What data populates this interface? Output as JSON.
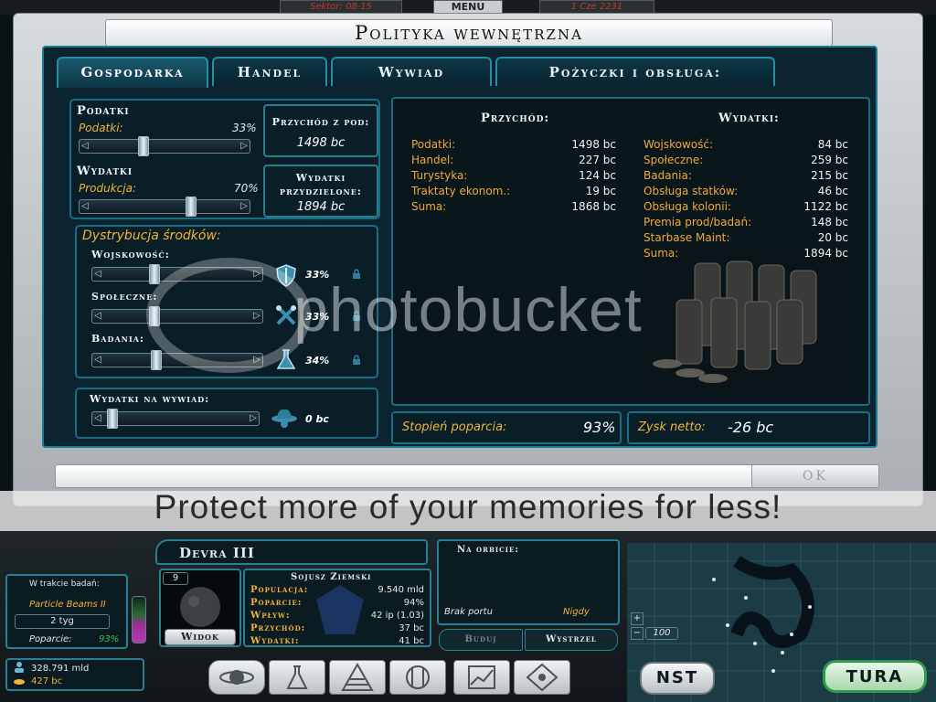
{
  "topbar": {
    "sector": "Sektor: 08-15",
    "menu": "MENU",
    "date": "1 Cze 2231"
  },
  "dialog": {
    "title": "Polityka wewnętrzna",
    "ok_label": "OK"
  },
  "tabs": [
    "Gospodarka",
    "Handel",
    "Wywiad",
    "Pożyczki i obsługa:"
  ],
  "taxes": {
    "header": "Podatki",
    "label": "Podatki:",
    "pct": "33%",
    "value": 0.33,
    "income_title": "Przychód z pod:",
    "income_value": "1498 bc"
  },
  "spending": {
    "header": "Wydatki",
    "label": "Produkcja:",
    "pct": "70%",
    "value": 0.7,
    "alloc_title_1": "Wydatki",
    "alloc_title_2": "przydzielone:",
    "alloc_value": "1894 bc"
  },
  "distribution": {
    "title": "Dystrybucja środków:",
    "items": [
      {
        "label": "Wojskowość:",
        "pct": "33%",
        "value": 0.33,
        "icon": "shield-icon"
      },
      {
        "label": "Społeczne:",
        "pct": "33%",
        "value": 0.33,
        "icon": "tools-icon"
      },
      {
        "label": "Badania:",
        "pct": "34%",
        "value": 0.34,
        "icon": "flask-icon"
      }
    ]
  },
  "intel": {
    "label": "Wydatki na wywiad:",
    "value_text": "0 bc",
    "value": 0.0
  },
  "income_table": {
    "head": "Przychód:",
    "rows": [
      {
        "k": "Podatki:",
        "v": "1498 bc"
      },
      {
        "k": "Handel:",
        "v": "227 bc"
      },
      {
        "k": "Turystyka:",
        "v": "124 bc"
      },
      {
        "k": "Traktaty ekonom.:",
        "v": "19 bc"
      },
      {
        "k": "Suma:",
        "v": "1868 bc"
      }
    ]
  },
  "expense_table": {
    "head": "Wydatki:",
    "rows": [
      {
        "k": "Wojskowość:",
        "v": "84 bc"
      },
      {
        "k": "Społeczne:",
        "v": "259 bc"
      },
      {
        "k": "Badania:",
        "v": "215 bc"
      },
      {
        "k": "Obsługa statków:",
        "v": "46 bc"
      },
      {
        "k": "Obsługa kolonii:",
        "v": "1122 bc"
      },
      {
        "k": "Premia prod/badań:",
        "v": "148 bc"
      },
      {
        "k": "Starbase Maint:",
        "v": "20 bc"
      },
      {
        "k": "Suma:",
        "v": "1894 bc"
      }
    ]
  },
  "footer": {
    "support_label": "Stopień poparcia:",
    "support_value": "93%",
    "net_label": "Zysk netto:",
    "net_value": "-26 bc"
  },
  "watermark": {
    "brand": "photobucket",
    "tagline": "Protect more of your memories for less!"
  },
  "hud": {
    "research_title": "W trakcie badań:",
    "research_item": "Particle Beams II",
    "research_time": "2 tyg",
    "support_label": "Poparcie:",
    "support_value": "93%",
    "population_total": "328.791 mld",
    "money": "427 bc",
    "planet_name": "Devra III",
    "planet_size": "9",
    "view_button": "Widok",
    "faction": "Sojusz Ziemski",
    "stats": [
      {
        "k": "Populacja:",
        "v": "9.540 mld"
      },
      {
        "k": "Poparcie:",
        "v": "94%"
      },
      {
        "k": "Wpływ:",
        "v": "42 ip (1.03)"
      },
      {
        "k": "Przychód:",
        "v": "37 bc"
      },
      {
        "k": "Wydatki:",
        "v": "41 bc"
      }
    ],
    "orbit_title": "Na orbicie:",
    "port_label": "Brak portu",
    "port_value": "Nigdy",
    "build_button": "Buduj",
    "launch_button": "Wystrzel",
    "zoom_value": "100",
    "nst_button": "NST",
    "turn_button": "TURA"
  }
}
